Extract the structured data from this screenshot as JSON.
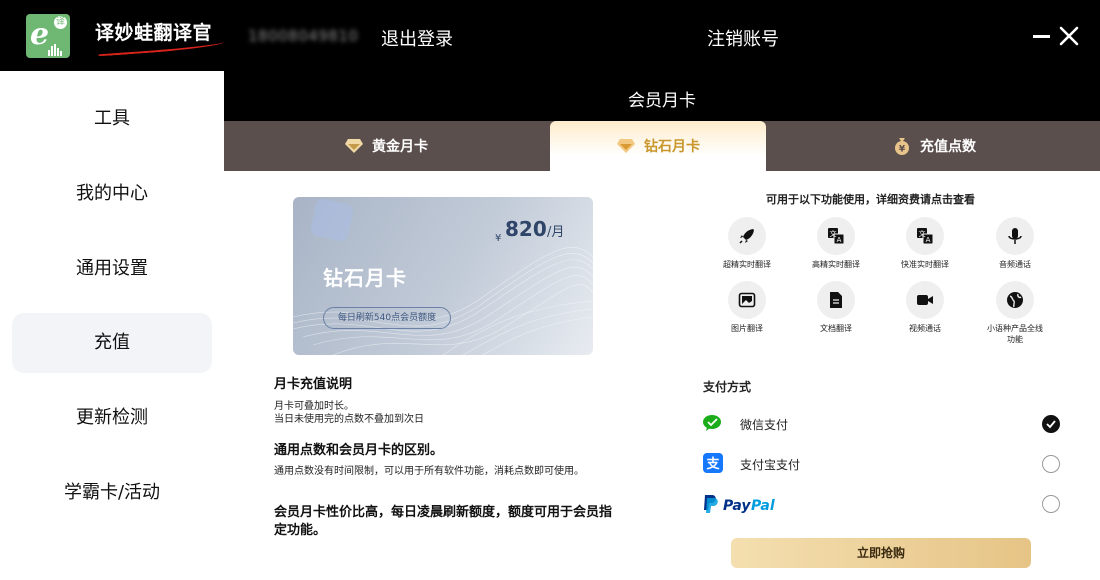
{
  "app": {
    "name": "译妙蛙翻译官",
    "logo_badge": "译"
  },
  "account": {
    "phone": "18008049810",
    "logout_label": "退出登录",
    "cancel_label": "注销账号"
  },
  "sidebar": {
    "items": [
      {
        "label": "工具"
      },
      {
        "label": "我的中心"
      },
      {
        "label": "通用设置"
      },
      {
        "label": "充值"
      },
      {
        "label": "更新检测"
      },
      {
        "label": "学霸卡/活动"
      }
    ],
    "active": "充值"
  },
  "header": {
    "title": "会员月卡"
  },
  "tabs": [
    {
      "label": "黄金月卡",
      "icon": "gold-diamond-icon"
    },
    {
      "label": "钻石月卡",
      "icon": "diamond-icon",
      "active": true
    },
    {
      "label": "充值点数",
      "icon": "money-bag-icon"
    }
  ],
  "card": {
    "currency": "¥",
    "price": "820",
    "unit": "/月",
    "name": "钻石月卡",
    "note": "每日刷新540点会员额度"
  },
  "info": {
    "h1": "月卡充值说明",
    "p1a": "月卡可叠加时长。",
    "p1b": "当日未使用完的点数不叠加到次日",
    "h2": "通用点数和会员月卡的区别。",
    "p2": "通用点数没有时间限制，可以用于所有软件功能，消耗点数即可使用。",
    "h3": "会员月卡性价比高，每日凌晨刷新额度，额度可用于会员指定功能。"
  },
  "features": {
    "title": "可用于以下功能使用，详细资费请点击查看",
    "items": [
      {
        "label": "超精实时翻译",
        "icon": "rocket-icon"
      },
      {
        "label": "高精实时翻译",
        "icon": "translate-icon"
      },
      {
        "label": "快准实时翻译",
        "icon": "translate-fast-icon"
      },
      {
        "label": "音频通话",
        "icon": "microphone-icon"
      },
      {
        "label": "图片翻译",
        "icon": "image-icon"
      },
      {
        "label": "文档翻译",
        "icon": "document-icon"
      },
      {
        "label": "视频通话",
        "icon": "video-camera-icon"
      },
      {
        "label": "小语种产品全线功能",
        "icon": "globe-icon"
      }
    ]
  },
  "payment": {
    "title": "支付方式",
    "methods": [
      {
        "label": "微信支付",
        "icon": "wechat-pay-icon",
        "selected": true
      },
      {
        "label": "支付宝支付",
        "icon": "alipay-icon",
        "selected": false
      },
      {
        "label": "PayPal",
        "icon": "paypal-icon",
        "selected": false
      }
    ],
    "buy_label": "立即抢购"
  },
  "colors": {
    "topbar": "#000000",
    "tabbar": "#5b4f4d",
    "active_tab_text": "#c8962b",
    "wechat": "#1aad19",
    "alipay": "#1677ff",
    "paypal_dark": "#003087",
    "paypal_light": "#009cde",
    "buy_button": "#e6c486"
  }
}
